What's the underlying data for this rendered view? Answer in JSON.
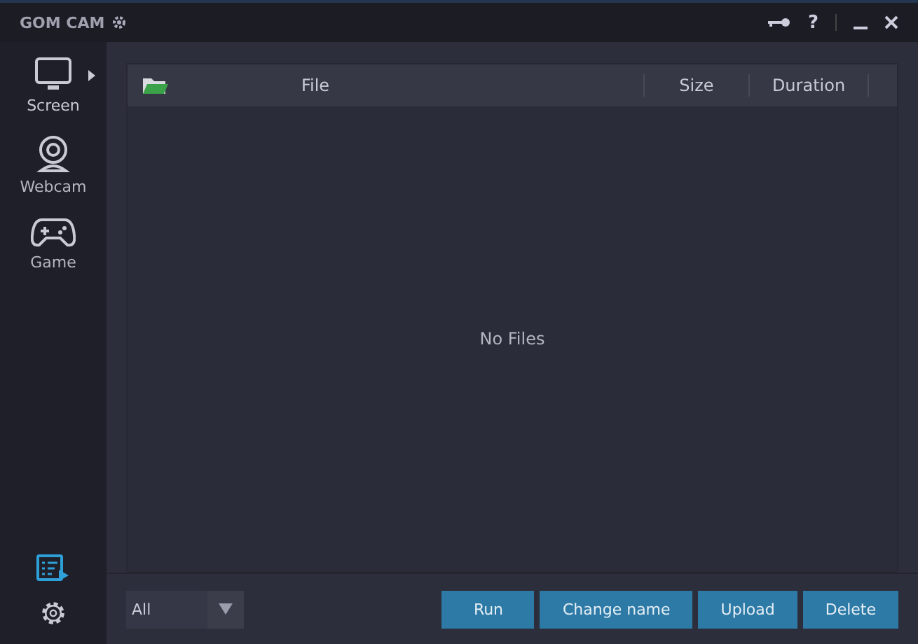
{
  "window": {
    "title": "GOM CAM",
    "controls": [
      "?"
    ]
  },
  "sidebar": {
    "items": [
      {
        "kind": "screen",
        "label": "Screen",
        "selected": true
      },
      {
        "kind": "webcam",
        "label": "Webcam",
        "selected": false
      },
      {
        "kind": "game",
        "label": "Game",
        "selected": false
      }
    ]
  },
  "table": {
    "columns": [
      "File",
      "Size",
      "Duration"
    ],
    "empty_text": "No Files"
  },
  "filter": {
    "value": "All"
  },
  "buttons": [
    "Run",
    "Change name",
    "Upload",
    "Delete"
  ]
}
